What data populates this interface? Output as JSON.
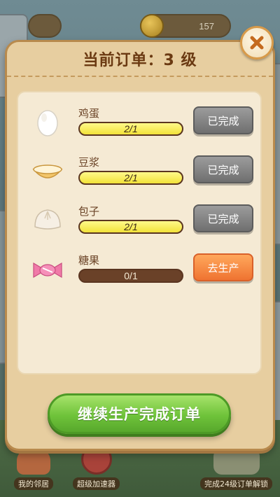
{
  "top_bar": {
    "currency_value": "157"
  },
  "dialog": {
    "title": "当前订单：3 级",
    "close_icon": "close-icon",
    "items": [
      {
        "name": "鸡蛋",
        "icon": "egg-icon",
        "progress_text": "2/1",
        "progress_fraction": 1.0,
        "action_label": "已完成",
        "status": "completed"
      },
      {
        "name": "豆浆",
        "icon": "soy-milk-bowl-icon",
        "progress_text": "2/1",
        "progress_fraction": 1.0,
        "action_label": "已完成",
        "status": "completed"
      },
      {
        "name": "包子",
        "icon": "steamed-bun-icon",
        "progress_text": "2/1",
        "progress_fraction": 1.0,
        "action_label": "已完成",
        "status": "completed"
      },
      {
        "name": "糖果",
        "icon": "candy-icon",
        "progress_text": "0/1",
        "progress_fraction": 0.0,
        "action_label": "去生产",
        "status": "pending"
      }
    ],
    "continue_label": "继续生产完成订单"
  },
  "bottom_bar": {
    "neighbors_label": "我的邻居",
    "accelerator_label": "超级加速器",
    "unlock_label": "完成24级订单解锁"
  },
  "colors": {
    "dialog_bg": "#e7cea0",
    "panel_bg": "#f5ead4",
    "progress_fill": "#f2e23a",
    "done_button": "#7f7f7f",
    "go_button": "#ef7331",
    "continue_button": "#6fc33a"
  }
}
